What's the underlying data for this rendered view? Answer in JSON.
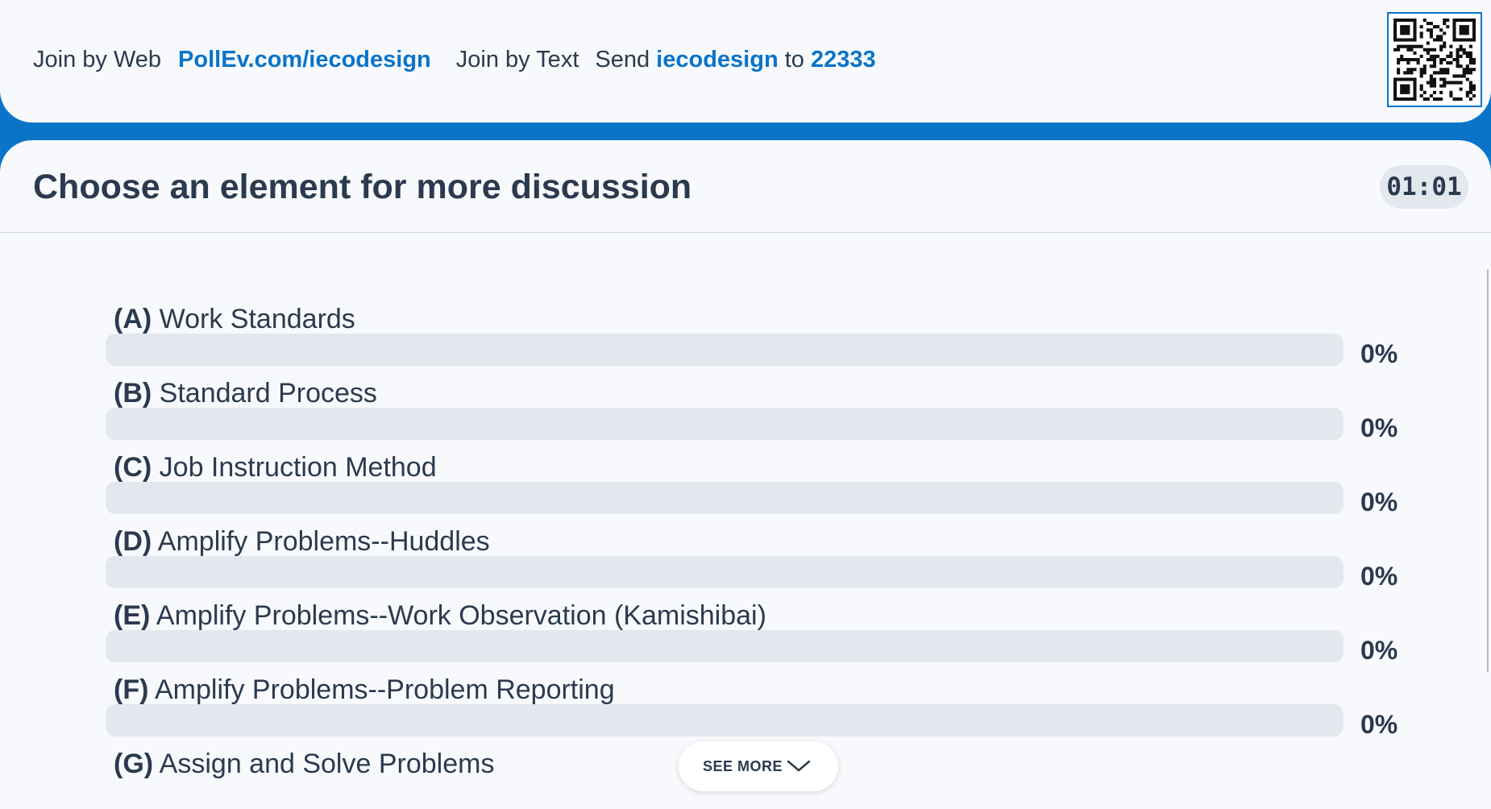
{
  "join": {
    "web_label": "Join by Web",
    "web_url": "PollEv.com/iecodesign",
    "text_label": "Join by Text",
    "send_word": "Send",
    "keyword": "iecodesign",
    "to_word": "to",
    "number": "22333"
  },
  "poll": {
    "title": "Choose an element for more discussion",
    "timer": "01:01",
    "options": [
      {
        "letter": "(A)",
        "text": "Work Standards",
        "percent": "0%",
        "value": 0
      },
      {
        "letter": "(B)",
        "text": "Standard Process",
        "percent": "0%",
        "value": 0
      },
      {
        "letter": "(C)",
        "text": "Job Instruction Method",
        "percent": "0%",
        "value": 0
      },
      {
        "letter": "(D)",
        "text": "Amplify Problems--Huddles",
        "percent": "0%",
        "value": 0
      },
      {
        "letter": "(E)",
        "text": "Amplify Problems--Work Observation (Kamishibai)",
        "percent": "0%",
        "value": 0
      },
      {
        "letter": "(F)",
        "text": "Amplify Problems--Problem Reporting",
        "percent": "0%",
        "value": 0
      },
      {
        "letter": "(G)",
        "text": "Assign and Solve Problems"
      }
    ],
    "see_more": "SEE MORE"
  },
  "icons": {
    "qr": "qr-code-icon",
    "chevron": "chevron-down-icon"
  },
  "colors": {
    "accent": "#0a74c9",
    "background": "#f7f9fc",
    "bar_track": "#e3e8ef",
    "text": "#2b3a4e"
  }
}
